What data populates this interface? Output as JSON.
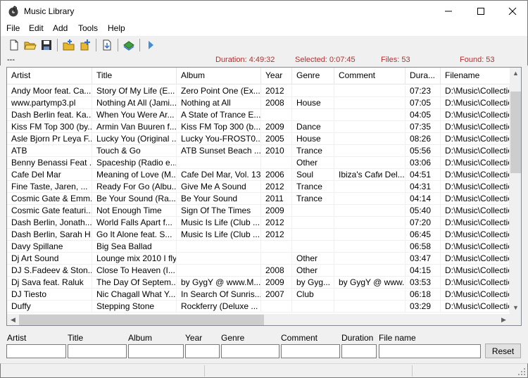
{
  "window": {
    "title": "Music Library"
  },
  "menu": [
    "File",
    "Edit",
    "Add",
    "Tools",
    "Help"
  ],
  "toolbar": {
    "icons": [
      "new-file-icon",
      "open-folder-icon",
      "save-icon",
      "add-folder-icon",
      "add-files-icon",
      "import-icon",
      "library-icon",
      "play-icon"
    ]
  },
  "status": {
    "dashes": "---",
    "duration": "Duration: 4:49:32",
    "selected": "Selected: 0:07:45",
    "files": "Files: 53",
    "found": "Found: 53"
  },
  "grid": {
    "columns": [
      "Artist",
      "Title",
      "Album",
      "Year",
      "Genre",
      "Comment",
      "Dura...",
      "Filename"
    ],
    "rows": [
      [
        "Andy Moor feat. Ca...",
        "Story Of My Life (E...",
        "Zero Point One (Ex...",
        "2012",
        "",
        "",
        "07:23",
        "D:\\Music\\Collection"
      ],
      [
        "www.partymp3.pl",
        "Nothing At All (Jami...",
        "Nothing at All",
        "2008",
        "House",
        "",
        "07:05",
        "D:\\Music\\Collection"
      ],
      [
        "Dash Berlin feat. Ka...",
        "When You Were Ar...",
        "A State of Trance E...",
        "",
        "",
        "",
        "04:05",
        "D:\\Music\\Collection"
      ],
      [
        "Kiss FM Top 300 (by...",
        "Armin Van Buuren f...",
        "Kiss FM Top 300 (b...",
        "2009",
        "Dance",
        "",
        "07:35",
        "D:\\Music\\Collection"
      ],
      [
        "Asle Bjorn Pr Leya F...",
        "Lucky You (Original ...",
        "Lucky You-FROST0...",
        "2005",
        "House",
        "",
        "08:26",
        "D:\\Music\\Collection"
      ],
      [
        "ATB",
        "Touch & Go",
        "ATB Sunset Beach ...",
        "2010",
        "Trance",
        "",
        "05:56",
        "D:\\Music\\Collection"
      ],
      [
        "Benny Benassi Feat ...",
        "Spaceship (Radio e...",
        "",
        "",
        "Other",
        "",
        "03:06",
        "D:\\Music\\Collection"
      ],
      [
        "Cafe Del Mar",
        "Meaning of Love (M...",
        "Cafe Del Mar, Vol. 13",
        "2006",
        "Soul",
        "Ibiza's Cafи Del...",
        "04:51",
        "D:\\Music\\Collection"
      ],
      [
        "Fine Taste, Jaren, ...",
        "Ready For Go (Albu...",
        "Give Me A Sound",
        "2012",
        "Trance",
        "",
        "04:31",
        "D:\\Music\\Collection"
      ],
      [
        "Cosmic Gate & Emm...",
        "Be Your Sound (Ra...",
        "Be Your Sound",
        "2011",
        "Trance",
        "",
        "04:14",
        "D:\\Music\\Collection"
      ],
      [
        "Cosmic Gate featuri...",
        "Not Enough Time",
        "Sign Of The Times",
        "2009",
        "",
        "",
        "05:40",
        "D:\\Music\\Collection"
      ],
      [
        "Dash Berlin, Jonath...",
        "World Falls Apart f...",
        "Music Is Life (Club ...",
        "2012",
        "",
        "",
        "07:20",
        "D:\\Music\\Collection"
      ],
      [
        "Dash Berlin, Sarah H...",
        "Go It Alone feat. S...",
        "Music Is Life (Club ...",
        "2012",
        "",
        "",
        "06:45",
        "D:\\Music\\Collection"
      ],
      [
        "Davy Spillane",
        "Big Sea Ballad",
        "",
        "",
        "",
        "",
        "06:58",
        "D:\\Music\\Collection"
      ],
      [
        "Dj Art Sound",
        "Lounge mix 2010 I fly",
        "",
        "",
        "Other",
        "",
        "03:47",
        "D:\\Music\\Collection"
      ],
      [
        "DJ S.Fadeev & Ston...",
        "Close To Heaven (I...",
        "",
        "2008",
        "Other",
        "",
        "04:15",
        "D:\\Music\\Collection"
      ],
      [
        "Dj Sava feat. Raluk",
        "The Day Of Septem...",
        "by GygY @ www.M...",
        "2009",
        "by Gyg...",
        "by GygY @ www....",
        "03:53",
        "D:\\Music\\Collection"
      ],
      [
        "DJ Tiesto",
        "Nic Chagall  What Y...",
        "In Search Of Sunris...",
        "2007",
        "Club",
        "",
        "06:18",
        "D:\\Music\\Collection"
      ],
      [
        "Duffy",
        "Stepping Stone",
        "Rockferry (Deluxe ...",
        "",
        "",
        "",
        "03:29",
        "D:\\Music\\Collection"
      ]
    ]
  },
  "filters": {
    "labels": [
      "Artist",
      "Title",
      "Album",
      "Year",
      "Genre",
      "Comment",
      "Duration",
      "File name"
    ],
    "reset": "Reset"
  }
}
